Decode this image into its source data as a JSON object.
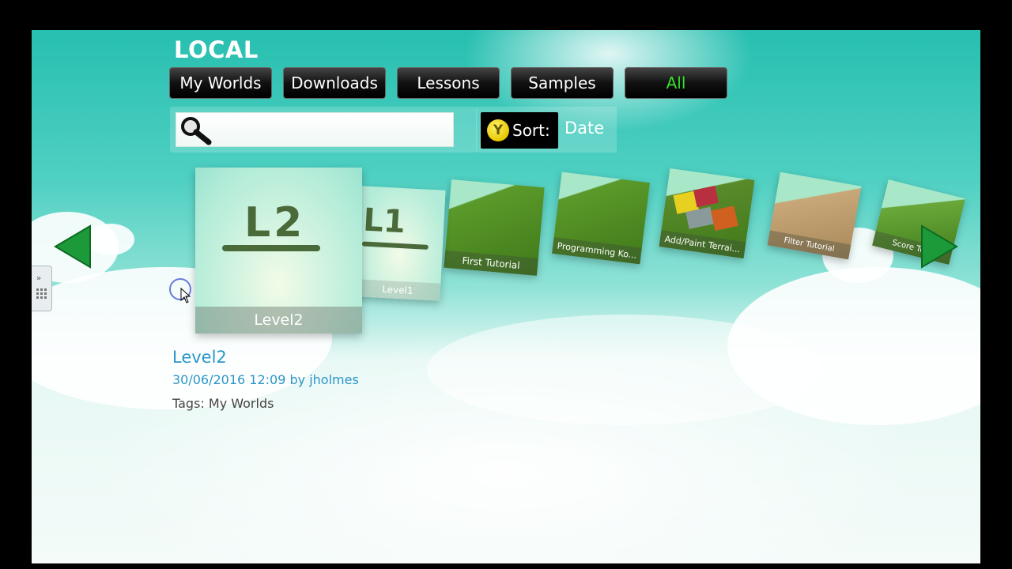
{
  "section_title": "LOCAL",
  "tabs": [
    {
      "label": "My Worlds",
      "active": false
    },
    {
      "label": "Downloads",
      "active": false
    },
    {
      "label": "Lessons",
      "active": false
    },
    {
      "label": "Samples",
      "active": false
    },
    {
      "label": "All",
      "active": true
    }
  ],
  "search": {
    "value": "",
    "placeholder": ""
  },
  "sort": {
    "button_glyph": "Y",
    "label": "Sort:",
    "value": "Date"
  },
  "carousel": {
    "selected_label": "Level2",
    "selected_drawing_text": "L2",
    "items": [
      {
        "label": "Level1",
        "drawing_text": "L1"
      },
      {
        "label": "First Tutorial"
      },
      {
        "label": "Programming Ko..."
      },
      {
        "label": "Add/Paint Terrai..."
      },
      {
        "label": "Filter Tutorial"
      },
      {
        "label": "Score Tuto"
      }
    ]
  },
  "details": {
    "title": "Level2",
    "meta": "30/06/2016 12:09 by jholmes",
    "tags": "Tags: My Worlds"
  },
  "icons": {
    "prev": "arrow-left-icon",
    "next": "arrow-right-icon",
    "search": "magnifier-icon",
    "side": "side-panel-icon"
  },
  "colors": {
    "accent_green": "#36e02a",
    "link_blue": "#2a96c8",
    "arrow_green": "#1c9a3a"
  }
}
